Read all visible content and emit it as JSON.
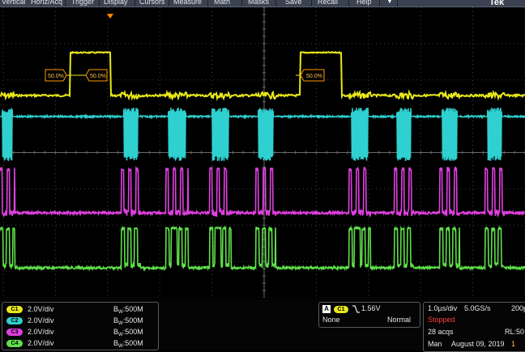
{
  "menu": {
    "items": [
      "Vertical",
      "Horiz/Acq",
      "Trigger",
      "Display",
      "Cursors",
      "Measure",
      "Math",
      "Masks",
      "Save",
      "Recall",
      "Help"
    ],
    "brand": "Tek"
  },
  "markers": {
    "labels": [
      "50.0%",
      "50.0%",
      "50.0%"
    ]
  },
  "channels": [
    {
      "badge": "C1",
      "scale": "2.0V/div",
      "bw_prefix": "B",
      "bw_sub": "W",
      "bw_value": ":500M",
      "color": "#e8e81a"
    },
    {
      "badge": "C2",
      "scale": "2.0V/div",
      "bw_prefix": "B",
      "bw_sub": "W",
      "bw_value": ":500M",
      "color": "#2fd0d0"
    },
    {
      "badge": "C3",
      "scale": "2.0V/div",
      "bw_prefix": "B",
      "bw_sub": "W",
      "bw_value": ":500M",
      "color": "#e040e0"
    },
    {
      "badge": "C4",
      "scale": "2.0V/div",
      "bw_prefix": "B",
      "bw_sub": "W",
      "bw_value": ":500M",
      "color": "#5fe04a"
    }
  ],
  "trigger": {
    "mode_badge": "A",
    "source_badge": "C1",
    "slope_icon": "falling-edge-icon",
    "level": "1.56V",
    "coupling": "None",
    "mode": "Normal"
  },
  "acquisition": {
    "timebase": "1.0µs/div",
    "sample_rate": "5.0GS/s",
    "point_spacing": "200p",
    "state": "Stopped",
    "acqs": "28 acqs",
    "record_length": "RL:50",
    "label": "Man",
    "date": "August 09, 2019",
    "time": "1"
  },
  "colors": {
    "ch1": "#e8e81a",
    "ch2": "#2fd0d0",
    "ch3": "#e040e0",
    "ch4": "#5fe04a",
    "trigger_marker": "#ff8a00",
    "menubar": "#3a4150",
    "stopped": "#ff3b3b"
  }
}
